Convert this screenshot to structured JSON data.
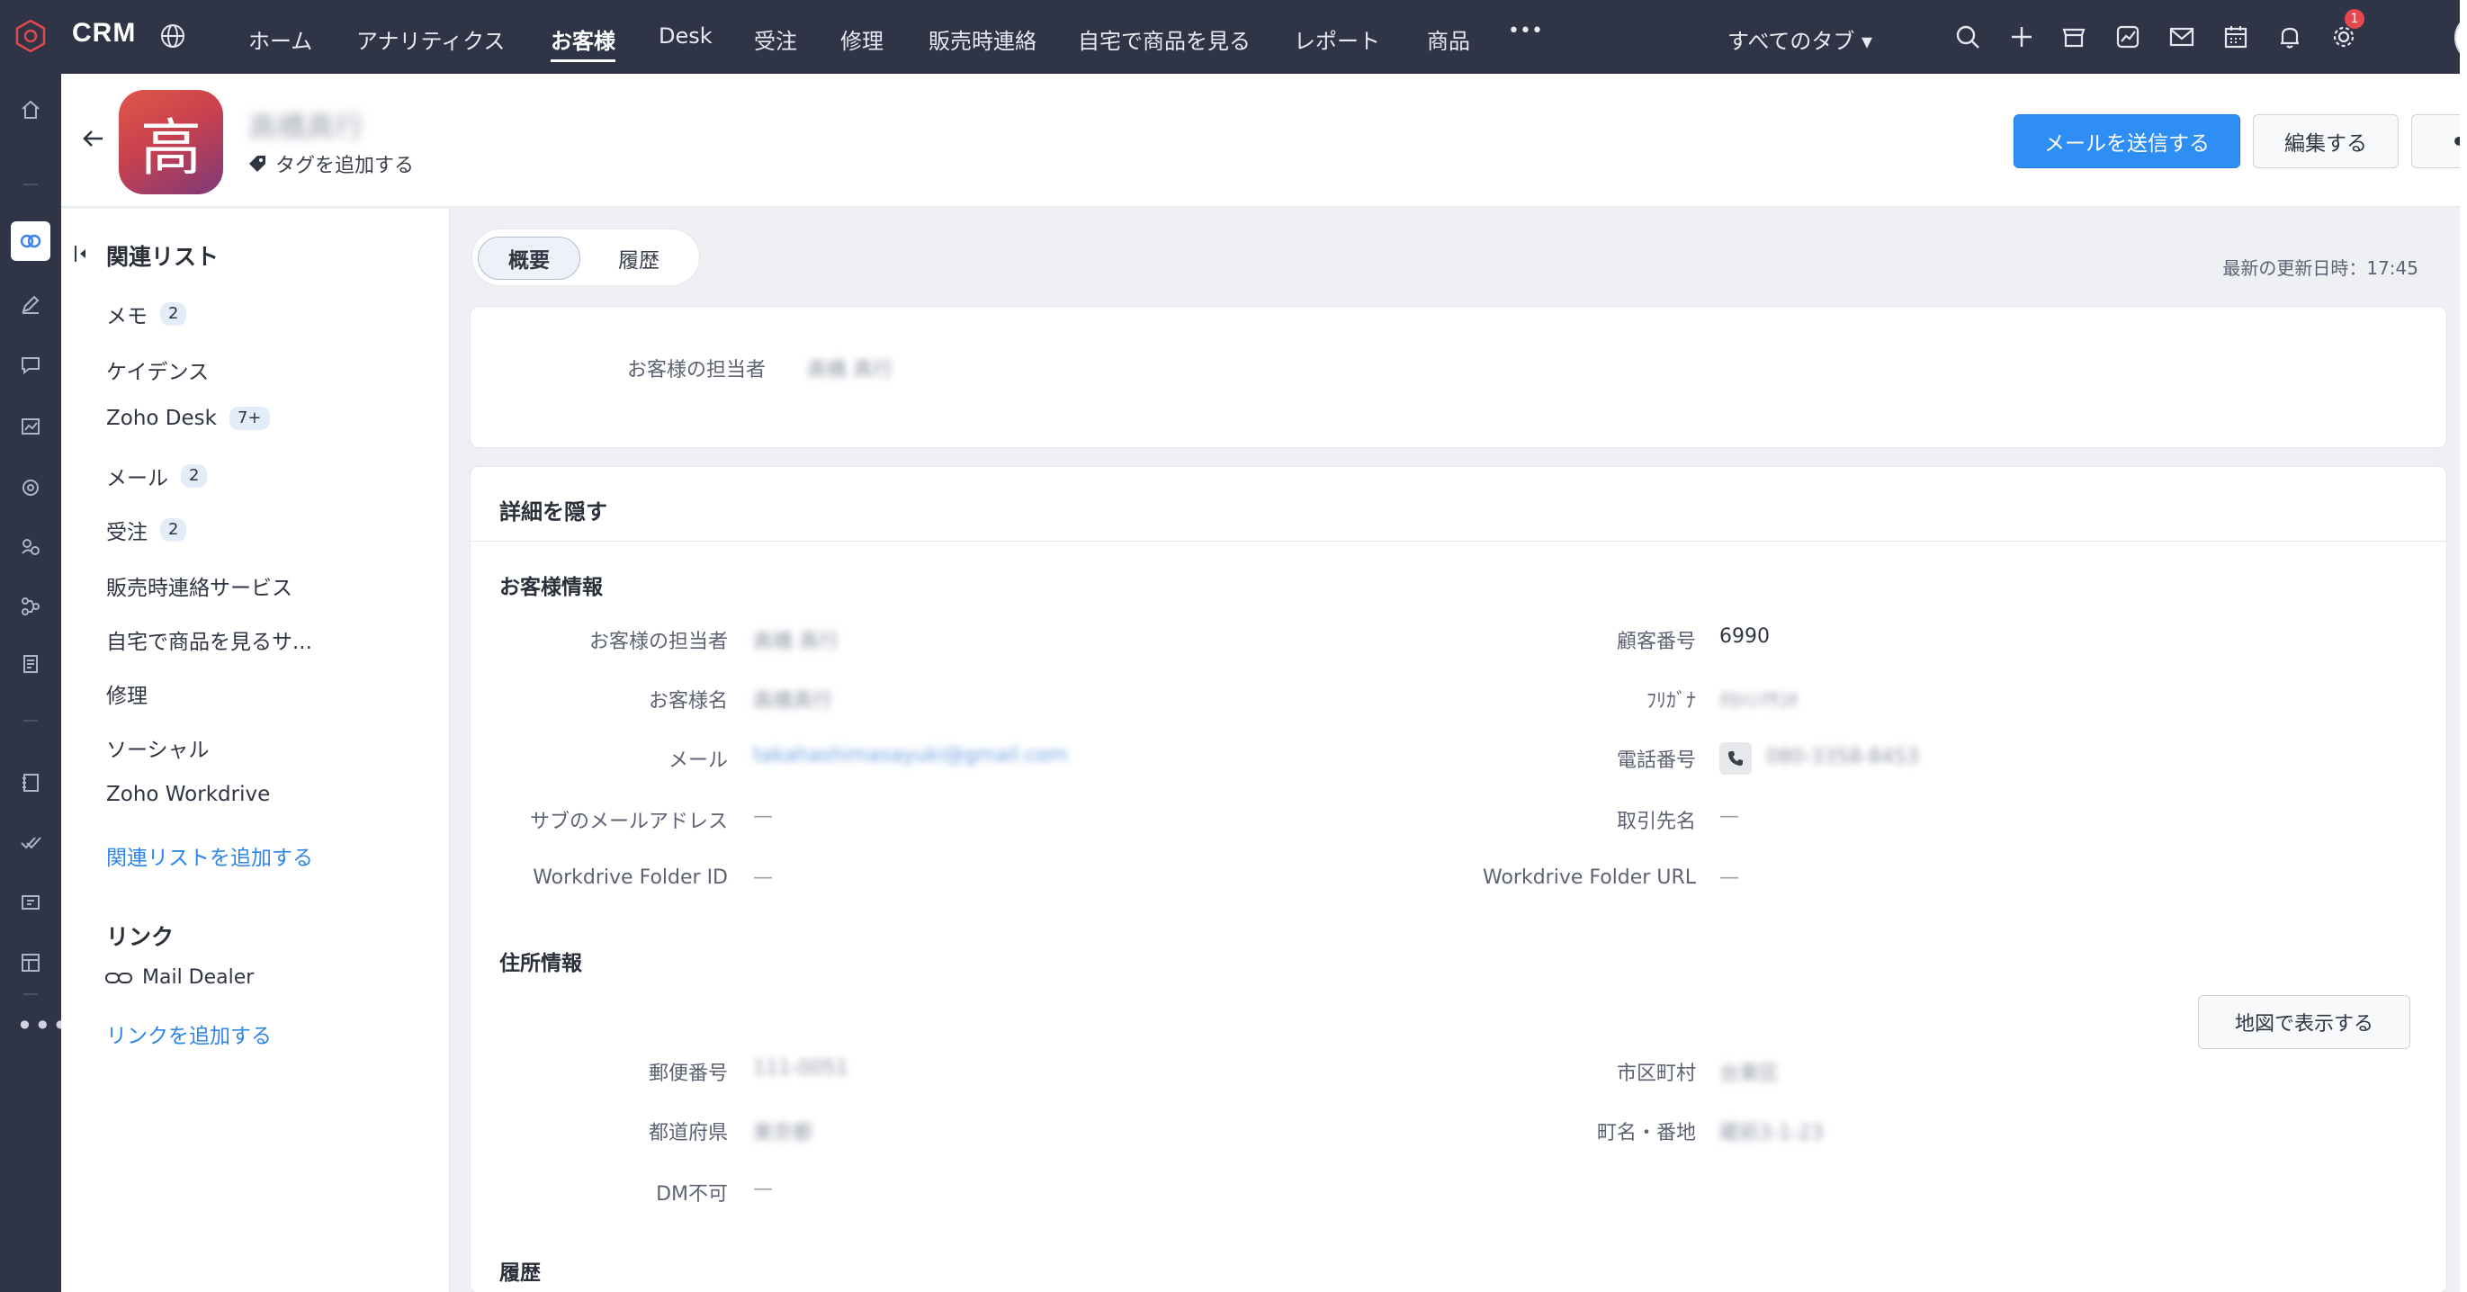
{
  "app": {
    "brand": "CRM"
  },
  "nav": {
    "items": [
      "ホーム",
      "アナリティクス",
      "お客様",
      "Desk",
      "受注",
      "修理",
      "販売時連絡",
      "自宅で商品を見る",
      "レポート",
      "商品"
    ],
    "active": "お客様",
    "more": "•••",
    "all_tabs": "すべてのタブ ▾",
    "notification_count": "1"
  },
  "record": {
    "avatar_letter": "高",
    "name": "高橋真行",
    "add_tag": "タグを追加する"
  },
  "actions": {
    "send_mail": "メールを送信する",
    "edit": "編集する",
    "more": "•••"
  },
  "related": {
    "title": "関連リスト",
    "items": [
      {
        "label": "メモ",
        "count": "2"
      },
      {
        "label": "ケイデンス",
        "count": ""
      },
      {
        "label": "Zoho Desk",
        "count": "7+"
      },
      {
        "label": "メール",
        "count": "2"
      },
      {
        "label": "受注",
        "count": "2"
      },
      {
        "label": "販売時連絡サービス",
        "count": ""
      },
      {
        "label": "自宅で商品を見るサ...",
        "count": ""
      },
      {
        "label": "修理",
        "count": ""
      },
      {
        "label": "ソーシャル",
        "count": ""
      },
      {
        "label": "Zoho Workdrive",
        "count": ""
      }
    ],
    "add_related": "関連リストを追加する",
    "links_title": "リンク",
    "link_item": "Mail Dealer",
    "add_link": "リンクを追加する"
  },
  "tabs": {
    "overview": "概要",
    "history": "履歴"
  },
  "last_updated": "最新の更新日時：17:45",
  "owner_card": {
    "label": "お客様の担当者",
    "value": "高橋 真行"
  },
  "details": {
    "toggle": "詳細を隠す",
    "customer_section": "お客様情報",
    "left_fields": [
      {
        "label": "お客様の担当者",
        "value": "高橋 真行"
      },
      {
        "label": "お客様名",
        "value": "高橋真行"
      },
      {
        "label": "メール",
        "value": "takahashimasayuki@gmail.com"
      },
      {
        "label": "サブのメールアドレス",
        "value": "—"
      },
      {
        "label": "Workdrive Folder ID",
        "value": "—"
      }
    ],
    "right_fields": [
      {
        "label": "顧客番号",
        "value": "6990"
      },
      {
        "label": "ﾌﾘｶﾞﾅ",
        "value": "ﾀｶﾊｼﾏｻﾕｷ"
      },
      {
        "label": "電話番号",
        "value": "080-3358-8453"
      },
      {
        "label": "取引先名",
        "value": "—"
      },
      {
        "label": "Workdrive Folder URL",
        "value": "—"
      }
    ],
    "address_section": "住所情報",
    "map_button": "地図で表示する",
    "address_left": [
      {
        "label": "郵便番号",
        "value": "111-0051"
      },
      {
        "label": "都道府県",
        "value": "東京都"
      },
      {
        "label": "DM不可",
        "value": "—"
      }
    ],
    "address_right": [
      {
        "label": "市区町村",
        "value": "台東区"
      },
      {
        "label": "町名・番地",
        "value": "蔵前3-1-23"
      }
    ],
    "history_section": "履歴"
  },
  "colors": {
    "nav_bg": "#2f3447",
    "primary": "#2f8ef4",
    "link": "#2f86e8"
  }
}
